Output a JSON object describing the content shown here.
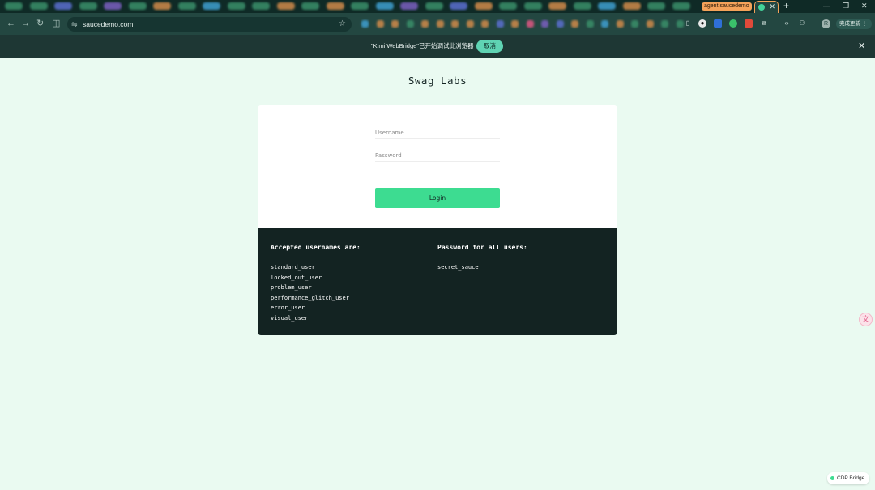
{
  "browser": {
    "tab_group_label": "agent:saucedemo",
    "tab_close": "✕",
    "new_tab": "+",
    "window_controls": [
      "—",
      "❐",
      "✕"
    ],
    "nav": {
      "back": "←",
      "forward": "→",
      "reload": "↻",
      "split": "◫"
    },
    "omnibox_url": "saucedemo.com",
    "omnibox_site_icon": "⇋",
    "bookmark_star": "☆",
    "profile_initial": "R",
    "update_button_label": "完成更新 ⋮",
    "blurred_tab_colors": [
      "#3a8f6a",
      "#3a8f6a",
      "#5b6fd0",
      "#3a8f6a",
      "#7b5fc0",
      "#3a8f6a",
      "#d08a4a",
      "#3a8f6a",
      "#3f9fd0",
      "#3a8f6a",
      "#3a8f6a",
      "#d08a4a",
      "#3a8f6a",
      "#d08a4a",
      "#3a8f6a",
      "#3f9fd0",
      "#7b5fc0",
      "#3a8f6a",
      "#5b6fd0",
      "#d08a4a",
      "#3a8f6a",
      "#3a8f6a",
      "#d08a4a",
      "#3a8f6a",
      "#3f9fd0",
      "#d08a4a",
      "#3a8f6a",
      "#3a8f6a"
    ],
    "blurred_extension_colors": [
      "#3f9fd0",
      "#d08a4a",
      "#d08a4a",
      "#3a8f6a",
      "#d08a4a",
      "#d08a4a",
      "#d08a4a",
      "#d08a4a",
      "#d08a4a",
      "#5b6fd0",
      "#d08a4a",
      "#e05783",
      "#7b5fc0",
      "#5b6fd0",
      "#d08a4a",
      "#3a8f6a",
      "#3f9fd0",
      "#d08a4a",
      "#3a8f6a",
      "#d08a4a",
      "#3a8f6a",
      "#3a8f6a"
    ]
  },
  "infobar": {
    "message": "\"Kimi WebBridge\"已开始调试此浏览器",
    "cancel_label": "取消",
    "close": "✕"
  },
  "page": {
    "logo": "Swag Labs",
    "username_placeholder": "Username",
    "password_placeholder": "Password",
    "login_label": "Login",
    "usernames_heading": "Accepted usernames are:",
    "usernames": [
      "standard_user",
      "locked_out_user",
      "problem_user",
      "performance_glitch_user",
      "error_user",
      "visual_user"
    ],
    "password_heading": "Password for all users:",
    "password_value": "secret_sauce"
  },
  "widgets": {
    "translate_glyph": "文",
    "cdp_label": "CDP Bridge"
  },
  "colors": {
    "page_bg": "#eafaf1",
    "accent_green": "#3ddc91",
    "dark_panel": "#132322",
    "tab_group_orange": "#f4a35a"
  }
}
